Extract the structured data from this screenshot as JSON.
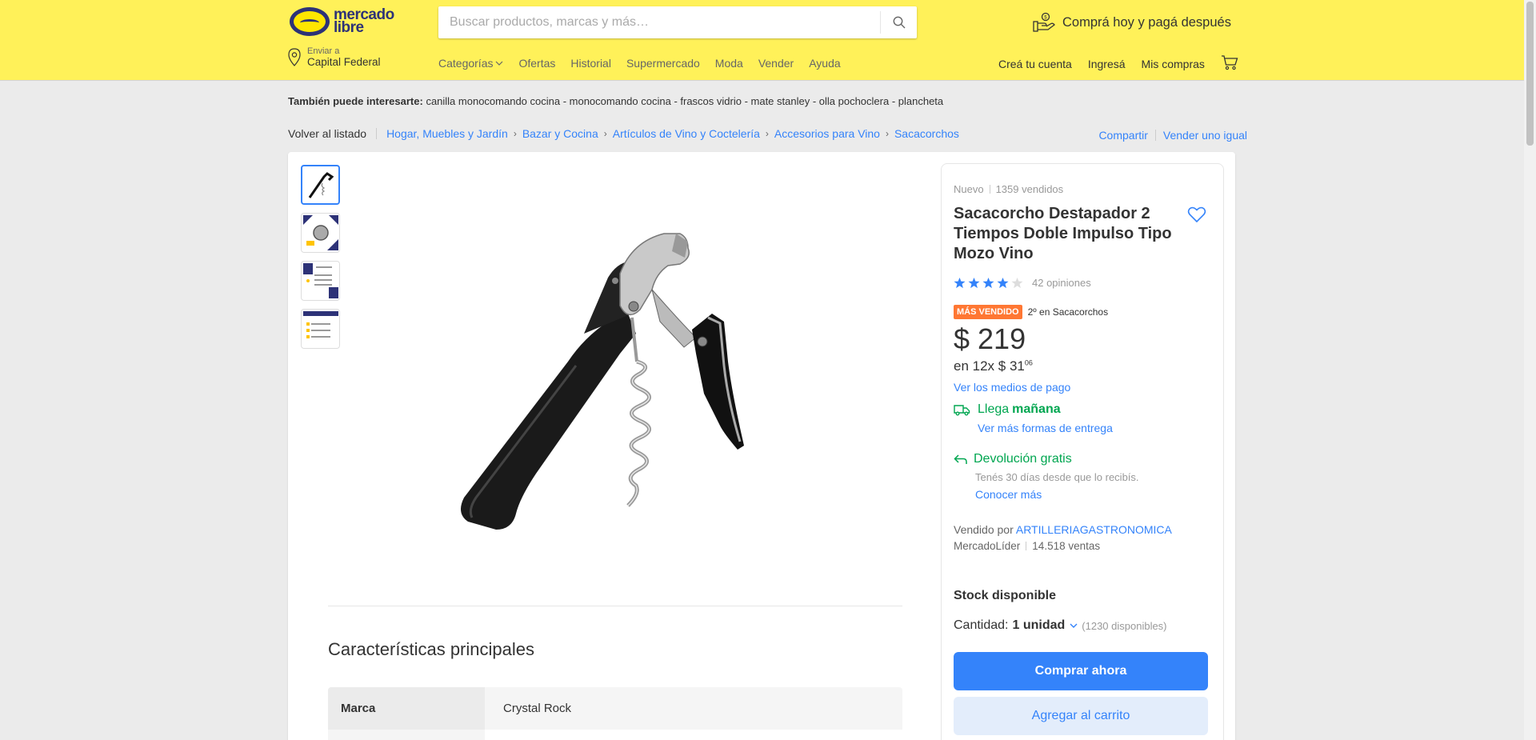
{
  "header": {
    "logo_line1": "mercado",
    "logo_line2": "libre",
    "search_placeholder": "Buscar productos, marcas y más…",
    "promo": "Comprá hoy y pagá después",
    "ship_label": "Enviar a",
    "ship_location": "Capital Federal",
    "nav": [
      "Categorías",
      "Ofertas",
      "Historial",
      "Supermercado",
      "Moda",
      "Vender",
      "Ayuda"
    ],
    "user_nav": [
      "Creá tu cuenta",
      "Ingresá",
      "Mis compras"
    ],
    "brand_color": "#fff159"
  },
  "interest": {
    "label": "También puede interesarte:",
    "items": "canilla monocomando cocina - monocomando cocina - frascos vidrio - mate stanley - olla pochoclera - plancheta"
  },
  "breadcrumb": {
    "back": "Volver al listado",
    "items": [
      "Hogar, Muebles y Jardín",
      "Bazar y Cocina",
      "Artículos de Vino y Coctelería",
      "Accesorios para Vino",
      "Sacacorchos"
    ],
    "share": "Compartir",
    "sell_same": "Vender uno igual"
  },
  "product": {
    "condition": "Nuevo",
    "sold": "1359 vendidos",
    "title": "Sacacorcho Destapador 2 Tiempos Doble Impulso Tipo Mozo Vino",
    "rating": 4,
    "reviews": "42 opiniones",
    "badge": "MÁS VENDIDO",
    "rank": "2º en Sacacorchos",
    "price": "$ 219",
    "installments_prefix": "en 12x $ 31",
    "installments_cents": "06",
    "pay_link": "Ver los medios de pago",
    "delivery_prefix": "Llega",
    "delivery_day": "mañana",
    "delivery_link": "Ver más formas de entrega",
    "returns_title": "Devolución gratis",
    "returns_sub": "Tenés 30 días desde que lo recibís.",
    "returns_link": "Conocer más",
    "seller_prefix": "Vendido por",
    "seller_name": "ARTILLERIAGASTRONOMICA",
    "seller_level": "MercadoLíder",
    "seller_sales": "14.518 ventas",
    "stock": "Stock disponible",
    "qty_label": "Cantidad:",
    "qty_value": "1 unidad",
    "qty_available": "(1230 disponibles)",
    "buy_now": "Comprar ahora",
    "add_cart": "Agregar al carrito",
    "accent_color": "#3483fa",
    "success_color": "#00a650"
  },
  "characteristics": {
    "title": "Características principales",
    "rows": [
      {
        "key": "Marca",
        "value": "Crystal Rock"
      }
    ]
  }
}
